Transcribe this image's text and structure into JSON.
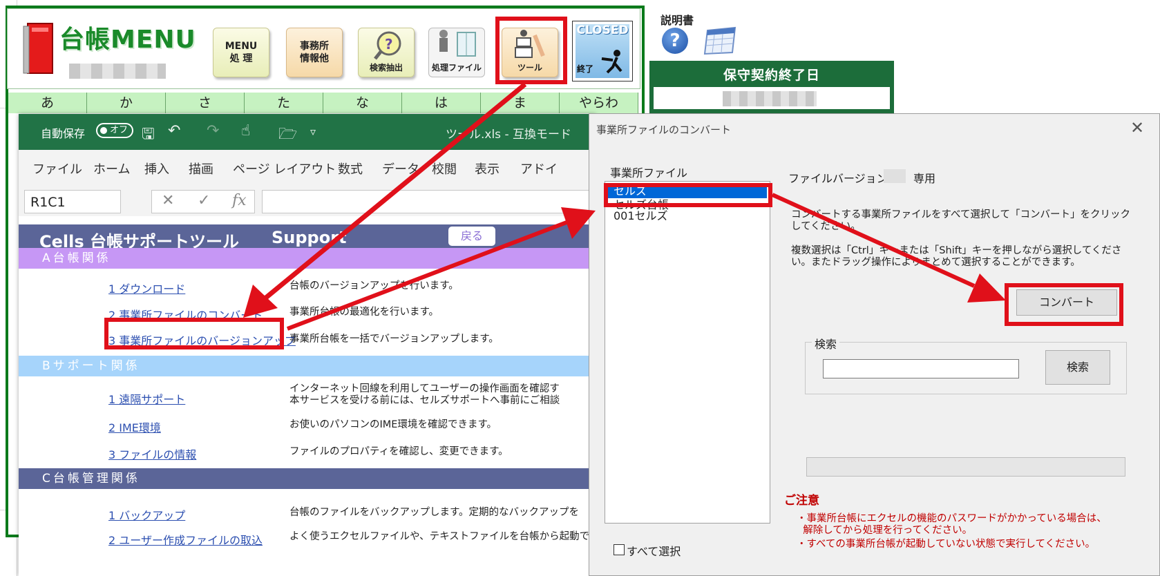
{
  "menu": {
    "title": "台帳MENU",
    "tiles": [
      {
        "label": "MENU\n処 理"
      },
      {
        "label": "事務所\n情報他"
      },
      {
        "label": "検索抽出"
      },
      {
        "label": "処理ファイル"
      },
      {
        "label": "ツール"
      }
    ],
    "closed": {
      "logo": "CLOSED",
      "label": "終了"
    },
    "kana": [
      "あ",
      "か",
      "さ",
      "た",
      "な",
      "は",
      "ま",
      "やらわ"
    ],
    "manual_label": "説明書",
    "contract_title": "保守契約終了日"
  },
  "excel": {
    "autosave_label": "自動保存",
    "autosave_state": "オフ",
    "file_title": "ツール.xls  -  互換モード",
    "ribbon_tabs": [
      "ファイル",
      "ホーム",
      "挿入",
      "描画",
      "ページ レイアウト",
      "数式",
      "データ",
      "校閲",
      "表示",
      "アドイ"
    ],
    "namebox": "R1C1",
    "fx": "fx",
    "support_title": "Cells  台帳サポートツール",
    "support_suffix": "Support",
    "back_label": "戻る",
    "sections": [
      {
        "title": "A台帳関係",
        "rows": [
          {
            "link": "1  ダウンロード",
            "desc": "台帳のバージョンアップを行います。"
          },
          {
            "link": "2  事業所ファイルのコンバート",
            "desc": "事業所台帳の最適化を行います。"
          },
          {
            "link": "3  事業所ファイルのバージョンアップ",
            "desc": "事業所台帳を一括でバージョンアップします。"
          }
        ]
      },
      {
        "title": "Bサポート関係",
        "rows": [
          {
            "link": "1  遠隔サポート",
            "desc": "インターネット回線を利用してユーザーの操作画面を確認す",
            "desc2": "本サービスを受ける前には、セルズサポートへ事前にご相談"
          },
          {
            "link": "2  IME環境",
            "desc": "お使いのパソコンのIME環境を確認できます。"
          },
          {
            "link": "3  ファイルの情報",
            "desc": "ファイルのプロパティを確認し、変更できます。"
          }
        ]
      },
      {
        "title": "C台帳管理関係",
        "rows": [
          {
            "link": "1  バックアップ",
            "desc": "台帳のファイルをバックアップします。定期的なバックアップを"
          },
          {
            "link": "2  ユーザー作成ファイルの取込",
            "desc": "よく使うエクセルファイルや、テキストファイルを台帳から起動で"
          }
        ]
      }
    ]
  },
  "dialog": {
    "title": "事業所ファイルのコンバート",
    "list_label": "事業所ファイル",
    "items": [
      "セルズ",
      "セルズ台帳",
      "001セルズ"
    ],
    "version_label": "ファイルバージョン",
    "version_suffix": "専用",
    "instruction_1": "コンバートする事業所ファイルをすべて選択して「コンバート」をクリックしてください。",
    "instruction_2": "複数選択は「Ctrl」キーまたは「Shift」キーを押しながら選択してください。またドラッグ操作によりまとめて選択することができます。",
    "convert_label": "コンバート",
    "search_legend": "検索",
    "search_button": "検索",
    "search_value": "",
    "notice_title": "ご注意",
    "notice_1": "・事業所台帳にエクセルの機能のパスワードがかかっている場合は、\n  解除してから処理を行ってください。",
    "notice_2": "・すべての事業所台帳が起動していない状態で実行してください。",
    "select_all_label": "すべて選択",
    "close_glyph": "✕"
  },
  "colors": {
    "excel_green": "#217346",
    "menu_green": "#0b7a1b",
    "annotation_red": "#e0101a",
    "selection_blue": "#0067d7"
  }
}
